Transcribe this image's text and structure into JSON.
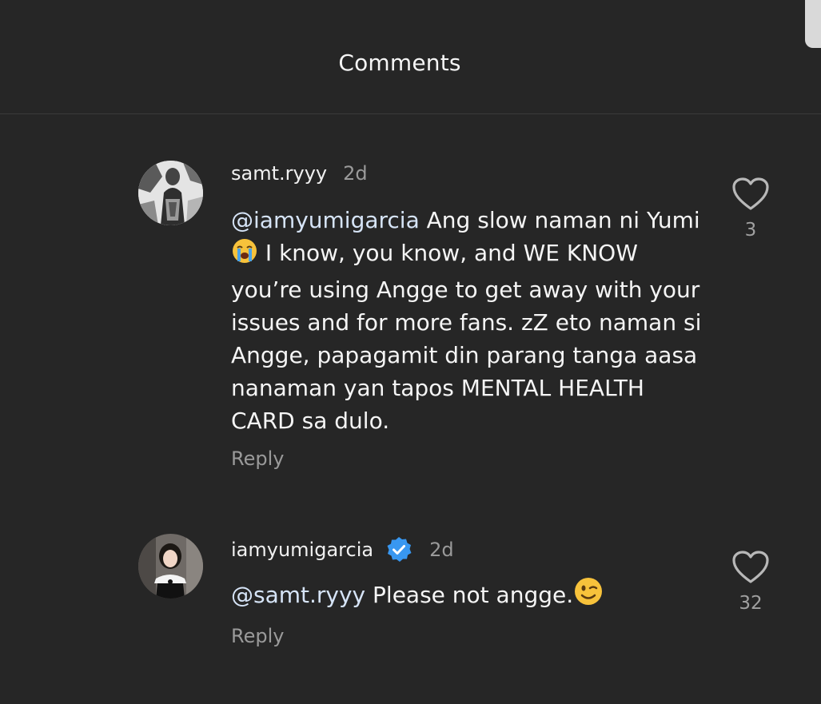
{
  "header": {
    "title": "Comments"
  },
  "comments": [
    {
      "username": "samt.ryyy",
      "time": "2d",
      "mention": "@iamyumigarcia",
      "text_part1": "Ang slow naman ni Yumi",
      "emoji": "crying-face",
      "text_part2": "I know, you know, and WE KNOW you’re using Angge to get away with your issues and for more fans. zZ eto naman si Angge, papagamit din parang tanga aasa nanaman yan tapos MENTAL HEALTH CARD sa dulo.",
      "reply_label": "Reply",
      "likes": "3"
    },
    {
      "username": "iamyumigarcia",
      "verified": true,
      "time": "2d",
      "mention": "@samt.ryyy",
      "text_part1": "Please not angge.",
      "emoji": "winking-face",
      "reply_label": "Reply",
      "likes": "32"
    }
  ],
  "colors": {
    "background": "#262626",
    "mention": "#d6e4f7",
    "muted": "#9a9a9a",
    "verified": "#3897f0"
  }
}
